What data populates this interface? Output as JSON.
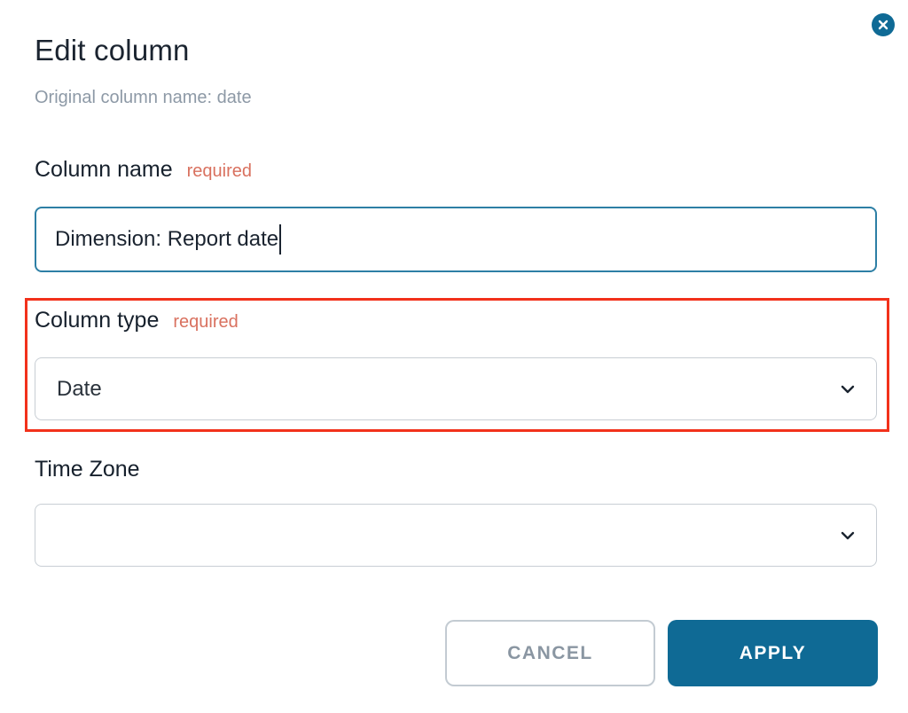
{
  "dialog": {
    "title": "Edit column",
    "subtitle": "Original column name: date"
  },
  "fields": {
    "column_name": {
      "label": "Column name",
      "required_text": "required",
      "value": "Dimension: Report date"
    },
    "column_type": {
      "label": "Column type",
      "required_text": "required",
      "selected": "Date"
    },
    "time_zone": {
      "label": "Time Zone",
      "selected": ""
    }
  },
  "buttons": {
    "cancel": "CANCEL",
    "apply": "APPLY"
  },
  "colors": {
    "accent": "#0f6a95",
    "required": "#d9715f",
    "highlight": "#f2311b"
  },
  "icons": {
    "close": "close-icon",
    "chevron": "chevron-down-icon"
  }
}
